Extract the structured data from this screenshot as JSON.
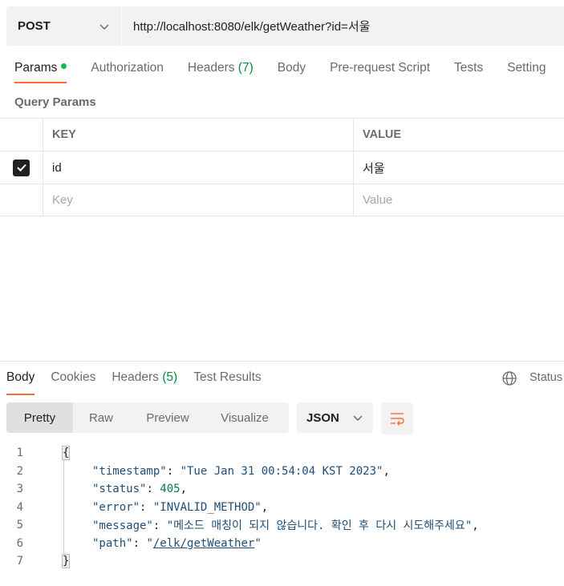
{
  "request": {
    "method": "POST",
    "url": "http://localhost:8080/elk/getWeather?id=서울"
  },
  "request_tabs": [
    {
      "label": "Params",
      "count": "",
      "active": true
    },
    {
      "label": "Authorization",
      "count": ""
    },
    {
      "label": "Headers",
      "count": "(7)"
    },
    {
      "label": "Body",
      "count": ""
    },
    {
      "label": "Pre-request Script",
      "count": ""
    },
    {
      "label": "Tests",
      "count": ""
    },
    {
      "label": "Setting",
      "count": ""
    }
  ],
  "query_params": {
    "title": "Query Params",
    "headers": {
      "key": "KEY",
      "value": "VALUE"
    },
    "rows": [
      {
        "key": "id",
        "value": "서울",
        "checked": true
      }
    ],
    "placeholder": {
      "key": "Key",
      "value": "Value"
    }
  },
  "response_tabs": [
    {
      "label": "Body",
      "count": "",
      "active": true
    },
    {
      "label": "Cookies",
      "count": ""
    },
    {
      "label": "Headers",
      "count": "(5)"
    },
    {
      "label": "Test Results",
      "count": ""
    }
  ],
  "status_label": "Status",
  "view_modes": [
    "Pretty",
    "Raw",
    "Preview",
    "Visualize"
  ],
  "format": "JSON",
  "response_body": {
    "line_numbers": [
      "1",
      "2",
      "3",
      "4",
      "5",
      "6",
      "7"
    ],
    "open_brace": "{",
    "close_brace": "}",
    "fields": [
      {
        "key": "\"timestamp\"",
        "value": "\"Tue Jan 31 00:54:04 KST 2023\"",
        "type": "string"
      },
      {
        "key": "\"status\"",
        "value": "405",
        "type": "number"
      },
      {
        "key": "\"error\"",
        "value": "\"INVALID_METHOD\"",
        "type": "string"
      },
      {
        "key": "\"message\"",
        "value": "\"메소드 매칭이 되지 않습니다. 확인 후 다시 시도해주세요\"",
        "type": "string"
      },
      {
        "key": "\"path\"",
        "value_prefix": "\"",
        "value_link": "/elk/getWeather",
        "value_suffix": "\"",
        "type": "link"
      }
    ]
  },
  "colors": {
    "accent": "#ff6c37",
    "params_dot": "#0cbb52",
    "count": "#0a8c3f"
  }
}
